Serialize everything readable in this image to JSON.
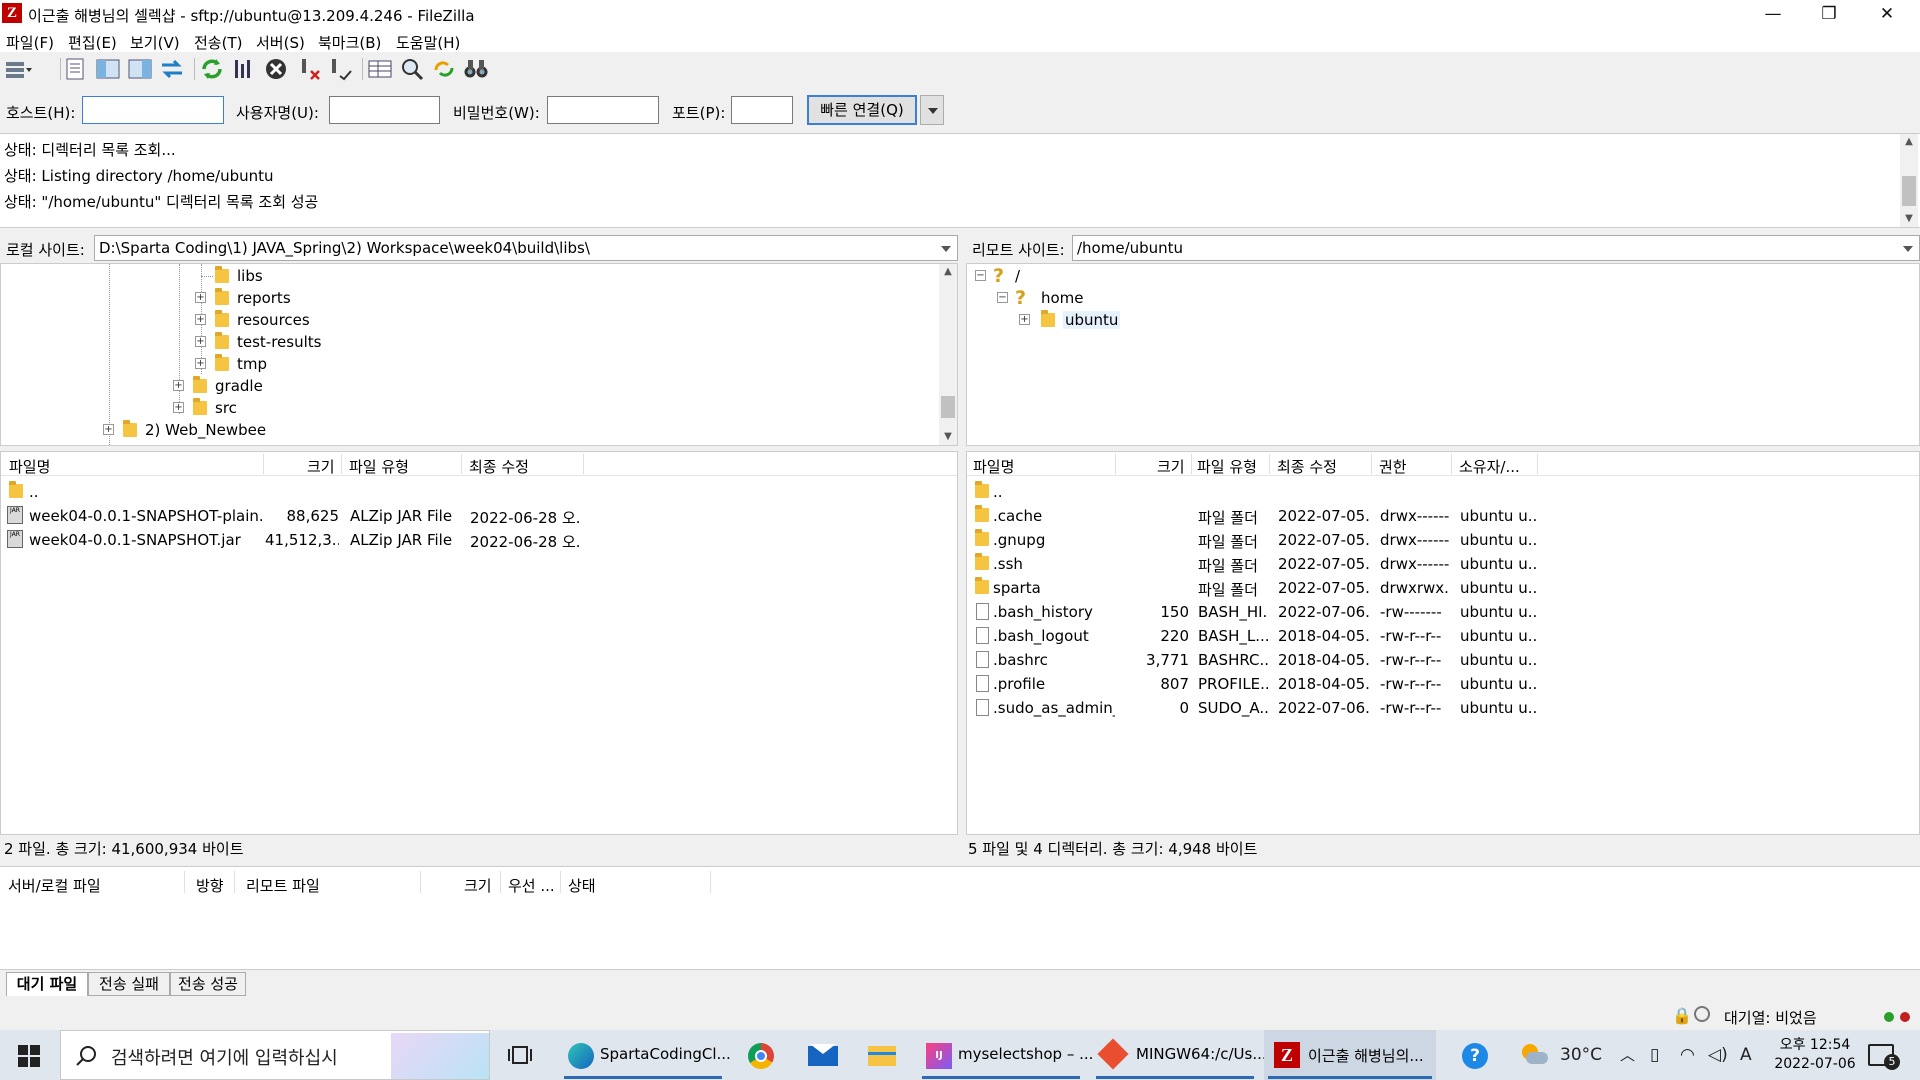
{
  "window": {
    "title": "이근출 해병님의 셀렉샵 - sftp://ubuntu@13.209.4.246 - FileZilla",
    "app_icon_letter": "Z"
  },
  "menu": [
    "파일(F)",
    "편집(E)",
    "보기(V)",
    "전송(T)",
    "서버(S)",
    "북마크(B)",
    "도움말(H)"
  ],
  "quickconnect": {
    "host_label": "호스트(H):",
    "user_label": "사용자명(U):",
    "pass_label": "비밀번호(W):",
    "port_label": "포트(P):",
    "host_value": "",
    "user_value": "",
    "pass_value": "",
    "port_value": "",
    "connect_label": "빠른 연결(Q)"
  },
  "log": [
    "상태: 디렉터리 목록 조회...",
    "상태: Listing directory /home/ubuntu",
    "상태: \"/home/ubuntu\" 디렉터리 목록 조회 성공"
  ],
  "local": {
    "site_label": "로컬 사이트:",
    "path": "D:\\Sparta Coding\\1) JAVA_Spring\\2) Workspace\\week04\\build\\libs\\",
    "tree": [
      "libs",
      "reports",
      "resources",
      "test-results",
      "tmp",
      "gradle",
      "src",
      "2) Web_Newbee"
    ],
    "columns": [
      "파일명",
      "크기",
      "파일 유형",
      "최종 수정"
    ],
    "files": [
      {
        "name": "..",
        "size": "",
        "type": "",
        "modified": ""
      },
      {
        "name": "week04-0.0.1-SNAPSHOT-plain.jar",
        "size": "88,625",
        "type": "ALZip JAR File",
        "modified": "2022-06-28 오..."
      },
      {
        "name": "week04-0.0.1-SNAPSHOT.jar",
        "size": "41,512,3...",
        "type": "ALZip JAR File",
        "modified": "2022-06-28 오..."
      }
    ],
    "status": "2 파일. 총 크기: 41,600,934 바이트"
  },
  "remote": {
    "site_label": "리모트 사이트:",
    "path": "/home/ubuntu",
    "tree": [
      "/",
      "home",
      "ubuntu"
    ],
    "columns": [
      "파일명",
      "크기",
      "파일 유형",
      "최종 수정",
      "권한",
      "소유자/..."
    ],
    "files": [
      {
        "name": "..",
        "size": "",
        "type": "",
        "modified": "",
        "perm": "",
        "owner": ""
      },
      {
        "name": ".cache",
        "size": "",
        "type": "파일 폴더",
        "modified": "2022-07-05...",
        "perm": "drwx------",
        "owner": "ubuntu u..."
      },
      {
        "name": ".gnupg",
        "size": "",
        "type": "파일 폴더",
        "modified": "2022-07-05...",
        "perm": "drwx------",
        "owner": "ubuntu u..."
      },
      {
        "name": ".ssh",
        "size": "",
        "type": "파일 폴더",
        "modified": "2022-07-05...",
        "perm": "drwx------",
        "owner": "ubuntu u..."
      },
      {
        "name": "sparta",
        "size": "",
        "type": "파일 폴더",
        "modified": "2022-07-05...",
        "perm": "drwxrwx...",
        "owner": "ubuntu u..."
      },
      {
        "name": ".bash_history",
        "size": "150",
        "type": "BASH_HI...",
        "modified": "2022-07-06...",
        "perm": "-rw-------",
        "owner": "ubuntu u..."
      },
      {
        "name": ".bash_logout",
        "size": "220",
        "type": "BASH_L...",
        "modified": "2018-04-05...",
        "perm": "-rw-r--r--",
        "owner": "ubuntu u..."
      },
      {
        "name": ".bashrc",
        "size": "3,771",
        "type": "BASHRC...",
        "modified": "2018-04-05...",
        "perm": "-rw-r--r--",
        "owner": "ubuntu u..."
      },
      {
        "name": ".profile",
        "size": "807",
        "type": "PROFILE...",
        "modified": "2018-04-05...",
        "perm": "-rw-r--r--",
        "owner": "ubuntu u..."
      },
      {
        "name": ".sudo_as_admin_...",
        "size": "0",
        "type": "SUDO_A...",
        "modified": "2022-07-06...",
        "perm": "-rw-r--r--",
        "owner": "ubuntu u..."
      }
    ],
    "status": "5 파일 및 4 디렉터리. 총 크기: 4,948 바이트"
  },
  "queue": {
    "columns": [
      "서버/로컬 파일",
      "방향",
      "리모트 파일",
      "크기",
      "우선 ...",
      "상태"
    ],
    "tabs": [
      "대기 파일",
      "전송 실패",
      "전송 성공"
    ],
    "queue_status": "대기열: 비었음"
  },
  "taskbar": {
    "search_placeholder": "검색하려면 여기에 입력하십시",
    "apps": [
      "SpartaCodingCl...",
      "myselectshop – ...",
      "MINGW64:/c/Us...",
      "이근출 해병님의..."
    ],
    "weather": "30°C",
    "ime": "A",
    "time": "오후 12:54",
    "date": "2022-07-06",
    "notifications": "5"
  },
  "colors": {
    "accent": "#3c7fd6",
    "folder": "#f5c542",
    "filezilla_red": "#bf0000",
    "taskbar": "#dfe6ee"
  }
}
